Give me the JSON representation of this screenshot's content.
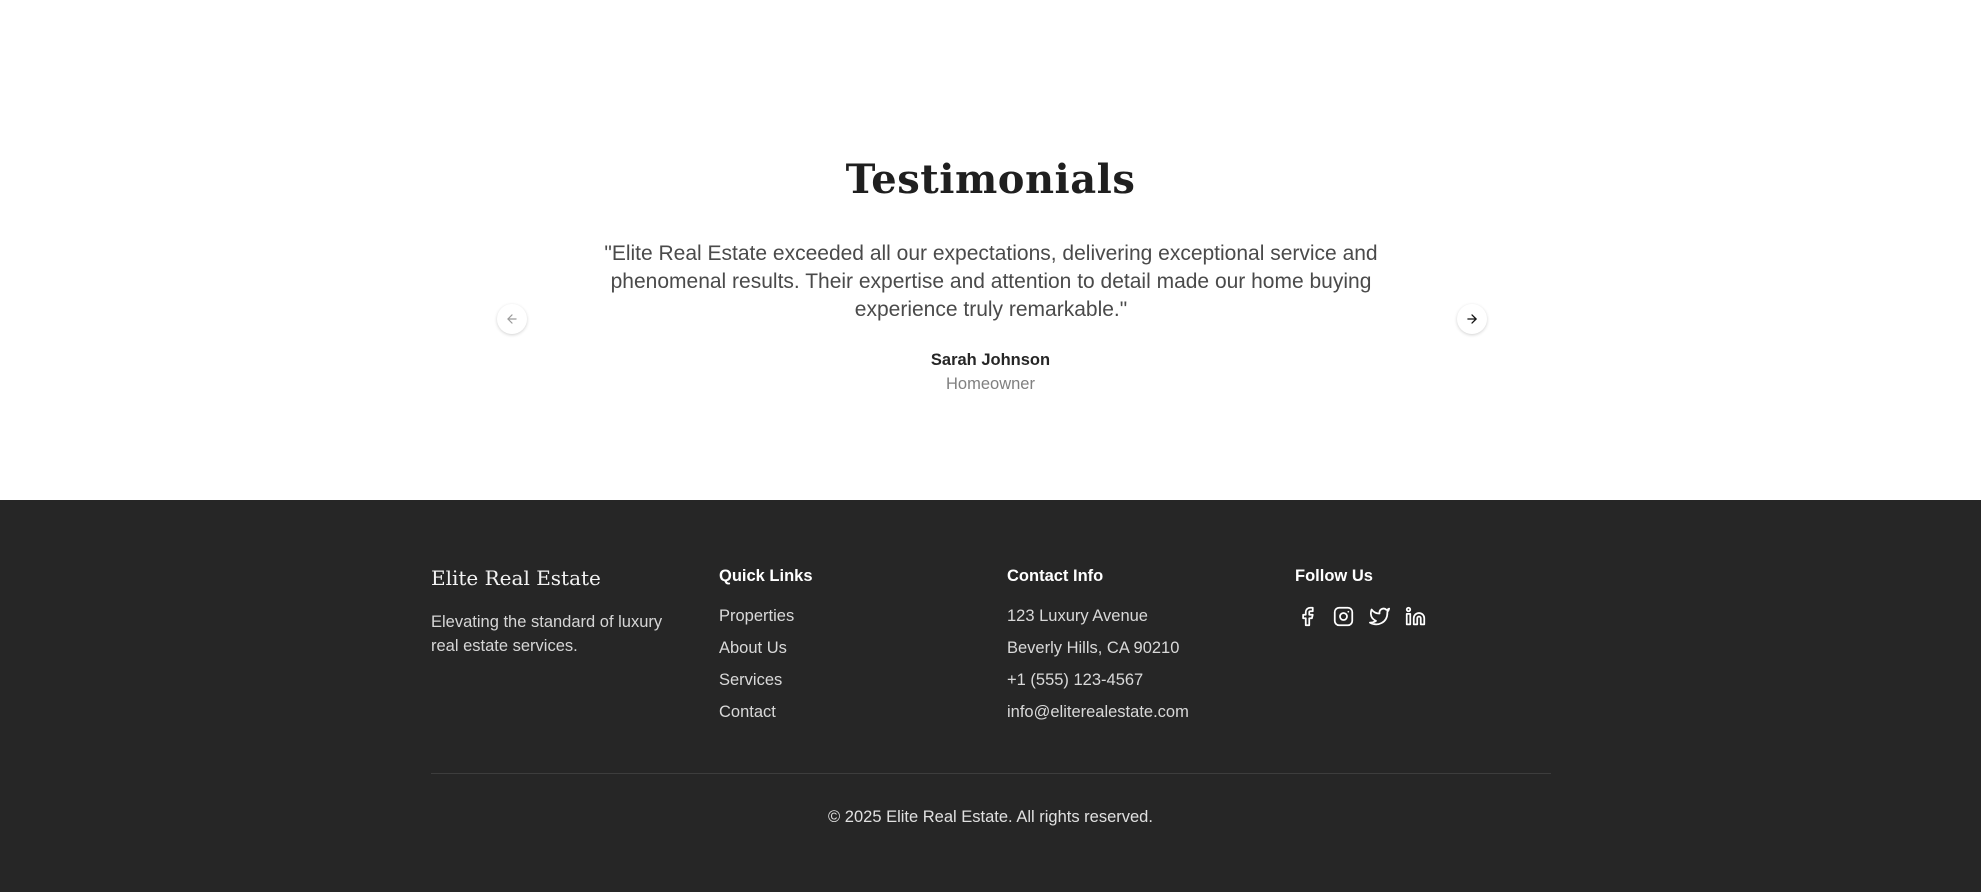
{
  "testimonials": {
    "title": "Testimonials",
    "quote": "\"Elite Real Estate exceeded all our expectations, delivering exceptional service and phenomenal results. Their expertise and attention to detail made our home buying experience truly remarkable.\"",
    "author": "Sarah Johnson",
    "role": "Homeowner",
    "prev_icon": "arrow-left-icon",
    "next_icon": "arrow-right-icon"
  },
  "footer": {
    "brand": {
      "title": "Elite Real Estate",
      "description": "Elevating the standard of luxury real estate services."
    },
    "quick_links": {
      "heading": "Quick Links",
      "items": [
        "Properties",
        "About Us",
        "Services",
        "Contact"
      ]
    },
    "contact": {
      "heading": "Contact Info",
      "items": [
        "123 Luxury Avenue",
        "Beverly Hills, CA 90210",
        "+1 (555) 123-4567",
        "info@eliterealestate.com"
      ]
    },
    "follow": {
      "heading": "Follow Us",
      "icons": [
        "facebook-icon",
        "instagram-icon",
        "twitter-icon",
        "linkedin-icon"
      ]
    },
    "copyright": "© 2025 Elite Real Estate. All rights reserved."
  },
  "colors": {
    "footer_bg": "#262626",
    "text_dark": "#1f1f1f",
    "text_muted": "#808080"
  }
}
